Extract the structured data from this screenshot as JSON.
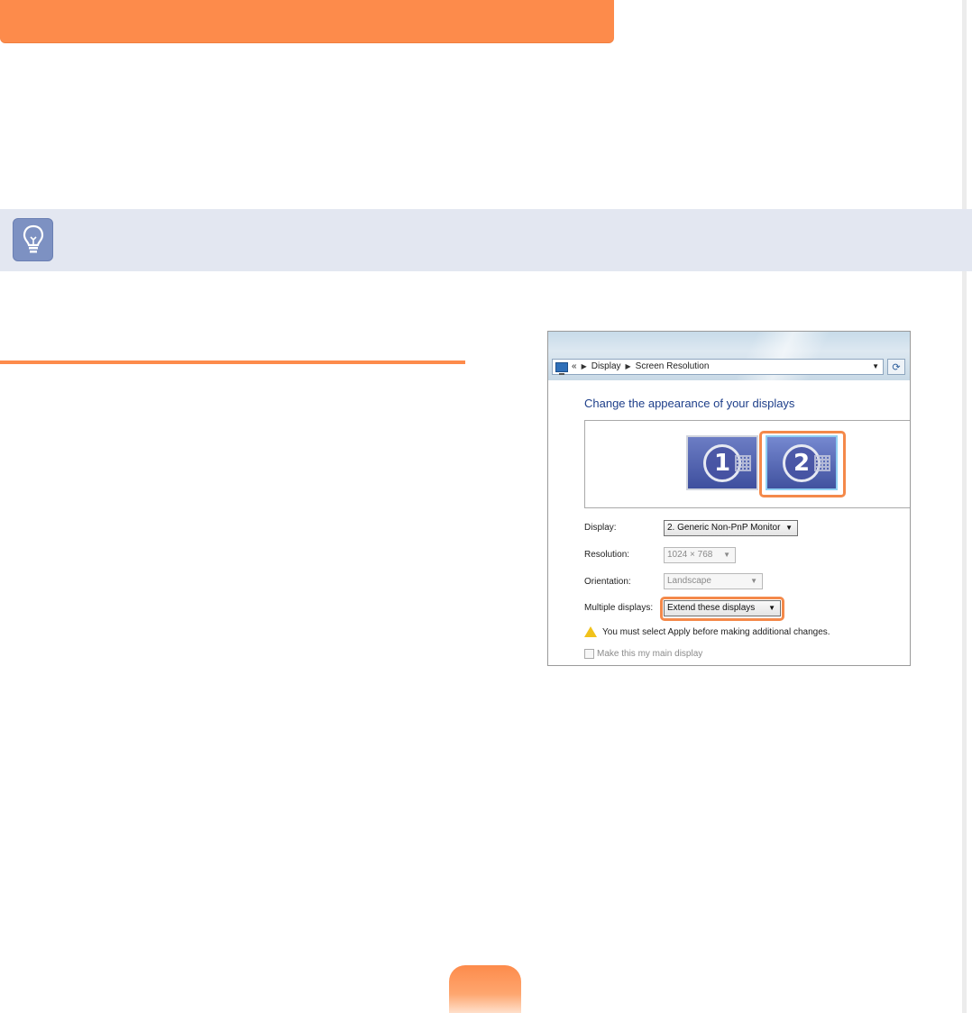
{
  "colors": {
    "accent": "#fd8b4b",
    "tip_background": "#e3e7f1",
    "tip_icon": "#7d91c2",
    "dialog_heading": "#1e3f8a",
    "highlight": "#f4894a"
  },
  "icons": {
    "tip": "lightbulb-icon",
    "address_bar": "monitor-icon",
    "refresh": "refresh-icon",
    "warning": "warning-icon"
  },
  "dialog": {
    "breadcrumb": {
      "back": "«",
      "items": [
        "Display",
        "Screen Resolution"
      ]
    },
    "heading": "Change the appearance of your displays",
    "monitors": [
      {
        "number": "1",
        "selected": false
      },
      {
        "number": "2",
        "selected": true
      }
    ],
    "fields": {
      "display": {
        "label": "Display:",
        "value": "2. Generic Non-PnP Monitor"
      },
      "resolution": {
        "label": "Resolution:",
        "value": "1024 × 768"
      },
      "orientation": {
        "label": "Orientation:",
        "value": "Landscape"
      },
      "multiple_displays": {
        "label": "Multiple displays:",
        "value": "Extend these displays"
      }
    },
    "warning": "You must select Apply before making additional changes.",
    "main_display_checkbox": "Make this my main display"
  }
}
